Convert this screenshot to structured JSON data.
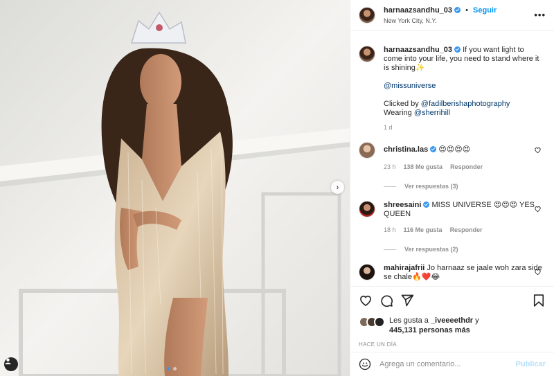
{
  "post": {
    "username": "harnaazsandhu_03",
    "follow_label": "Seguir",
    "location": "New York City, N.Y.",
    "separator": "•",
    "more_label": "•••",
    "caption": {
      "text": "If you want light to come into your life, you need to stand where it is shining✨",
      "mention": "@missuniverse",
      "clicked_prefix": "Clicked by ",
      "clicked_handle": "@fadilberishaphotography",
      "wearing_prefix": "Wearing ",
      "wearing_handle": "@sherrihill",
      "time": "1 d"
    },
    "comments": [
      {
        "user": "christina.las",
        "text": "😍😍😍😍",
        "time": "23 h",
        "likes": "138 Me gusta",
        "reply_label": "Responder",
        "view_replies": "Ver respuestas (3)"
      },
      {
        "user": "shreesaini",
        "text": "MISS UNIVERSE 😍😍😍 YES QUEEN",
        "time": "18 h",
        "likes": "116 Me gusta",
        "reply_label": "Responder",
        "view_replies": "Ver respuestas (2)"
      },
      {
        "user": "mahirajafrii",
        "text": "Jo harnaaz se jaale woh zara side se chale🔥❤️😂"
      }
    ],
    "likes": {
      "prefix": "Les gusta a ",
      "user": "_iveeeethdr",
      "and": " y",
      "count": "445,131 personas más"
    },
    "posted_ago": "HACE UN DÍA",
    "add_comment_placeholder": "Agrega un comentario...",
    "publish_label": "Publicar",
    "carousel": {
      "current": 1,
      "total": 2
    }
  },
  "icons": {
    "heart": "heart-icon",
    "comment": "comment-icon",
    "share": "share-icon",
    "save": "bookmark-icon",
    "emoji": "emoji-icon",
    "tag": "user-tag-icon",
    "next": "chevron-right-icon"
  },
  "colors": {
    "accent": "#0095f6",
    "verified": "#3897f0",
    "link": "#00376b",
    "muted": "#8e8e8e"
  }
}
